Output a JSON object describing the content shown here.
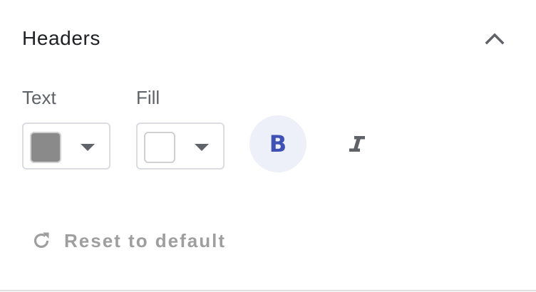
{
  "section": {
    "title": "Headers",
    "collapse_icon": "chevron-up-icon"
  },
  "text_color": {
    "label": "Text",
    "swatch_color": "#8a8a8a",
    "dropdown_icon": "caret-down-icon"
  },
  "fill_color": {
    "label": "Fill",
    "swatch_color": "#ffffff",
    "dropdown_icon": "caret-down-icon"
  },
  "bold": {
    "glyph": "B",
    "active": true,
    "active_bg": "#eef0f9",
    "active_color": "#3f51b5"
  },
  "italic": {
    "icon": "italic-icon",
    "active": false,
    "color": "#5f6368"
  },
  "reset": {
    "label": "Reset to default",
    "icon": "refresh-icon",
    "color": "#9e9e9e"
  }
}
